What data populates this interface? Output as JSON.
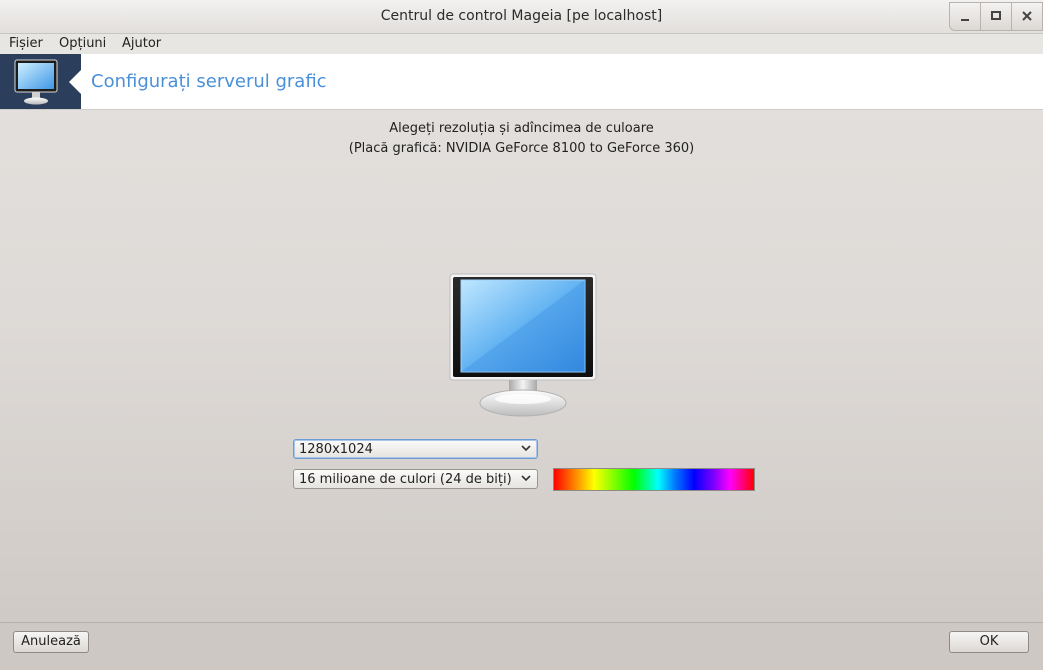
{
  "window": {
    "title": "Centrul de control Mageia  [pe localhost]"
  },
  "menu": {
    "file": "Fișier",
    "options": "Opțiuni",
    "help": "Ajutor"
  },
  "header": {
    "title": "Configurați serverul grafic",
    "icon": "monitor-icon"
  },
  "main": {
    "instruction": "Alegeți rezoluția și adîncimea de culoare",
    "graphics_card": "(Placă grafică: NVIDIA GeForce 8100 to GeForce 360)",
    "resolution": {
      "selected": "1280x1024"
    },
    "color_depth": {
      "selected": "16 milioane de culori (24 de biți)"
    }
  },
  "footer": {
    "cancel_label": "Anulează",
    "ok_label": "OK"
  },
  "colors": {
    "accent": "#4a90d9",
    "header_icon_bg": "#2b3f5c"
  }
}
